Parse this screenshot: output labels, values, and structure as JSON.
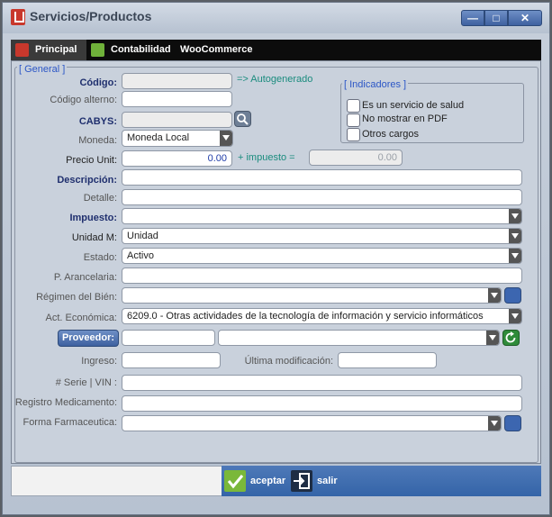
{
  "window": {
    "title": "Servicios/Productos",
    "min_label": "—",
    "max_label": "□",
    "close_label": "✕"
  },
  "tabs": [
    {
      "label": "Principal",
      "icon": "store-icon"
    },
    {
      "label": "Contabilidad",
      "icon": "chart-icon"
    },
    {
      "label": "WooCommerce",
      "icon": ""
    }
  ],
  "general": {
    "title": "[ General ]",
    "codigo_label": "Código:",
    "codigo_hint": "=> Autogenerado",
    "codigo_alterno_label": "Código alterno:",
    "cabys_label": "CABYS:",
    "moneda_label": "Moneda:",
    "moneda_value": "Moneda Local",
    "precio_label": "Precio Unit:",
    "precio_value": "0.00",
    "impuesto_hint": "+ impuesto =",
    "total_value": "0.00",
    "descripcion_label": "Descripción:",
    "detalle_label": "Detalle:",
    "impuesto_label": "Impuesto:",
    "unidad_label": "Unidad M:",
    "unidad_value": "Unidad",
    "estado_label": "Estado:",
    "estado_value": "Activo",
    "arancelaria_label": "P. Arancelaria:",
    "regimen_label": "Régimen del Bién:",
    "actividad_label": "Act. Económica:",
    "actividad_value": "6209.0 - Otras actividades de la tecnología de información y servicio informáticos",
    "proveedor_label": "Proveedor:",
    "ingreso_label": "Ingreso:",
    "ultima_mod_label": "Última modificación:",
    "serie_label": "# Serie | VIN :",
    "registro_label": "Registro Medicamento:",
    "forma_label": "Forma Farmaceutica:"
  },
  "indicadores": {
    "title": "[ Indicadores ]",
    "items": [
      "Es un servicio de salud",
      "No mostrar en PDF",
      "Otros cargos"
    ]
  },
  "actions": {
    "accept_label": "aceptar",
    "exit_label": "salir"
  },
  "colors": {
    "accent": "#3e61a0",
    "required_label": "#1f2f6e",
    "hint": "#1a8c7e",
    "accept": "#7ab83a"
  }
}
